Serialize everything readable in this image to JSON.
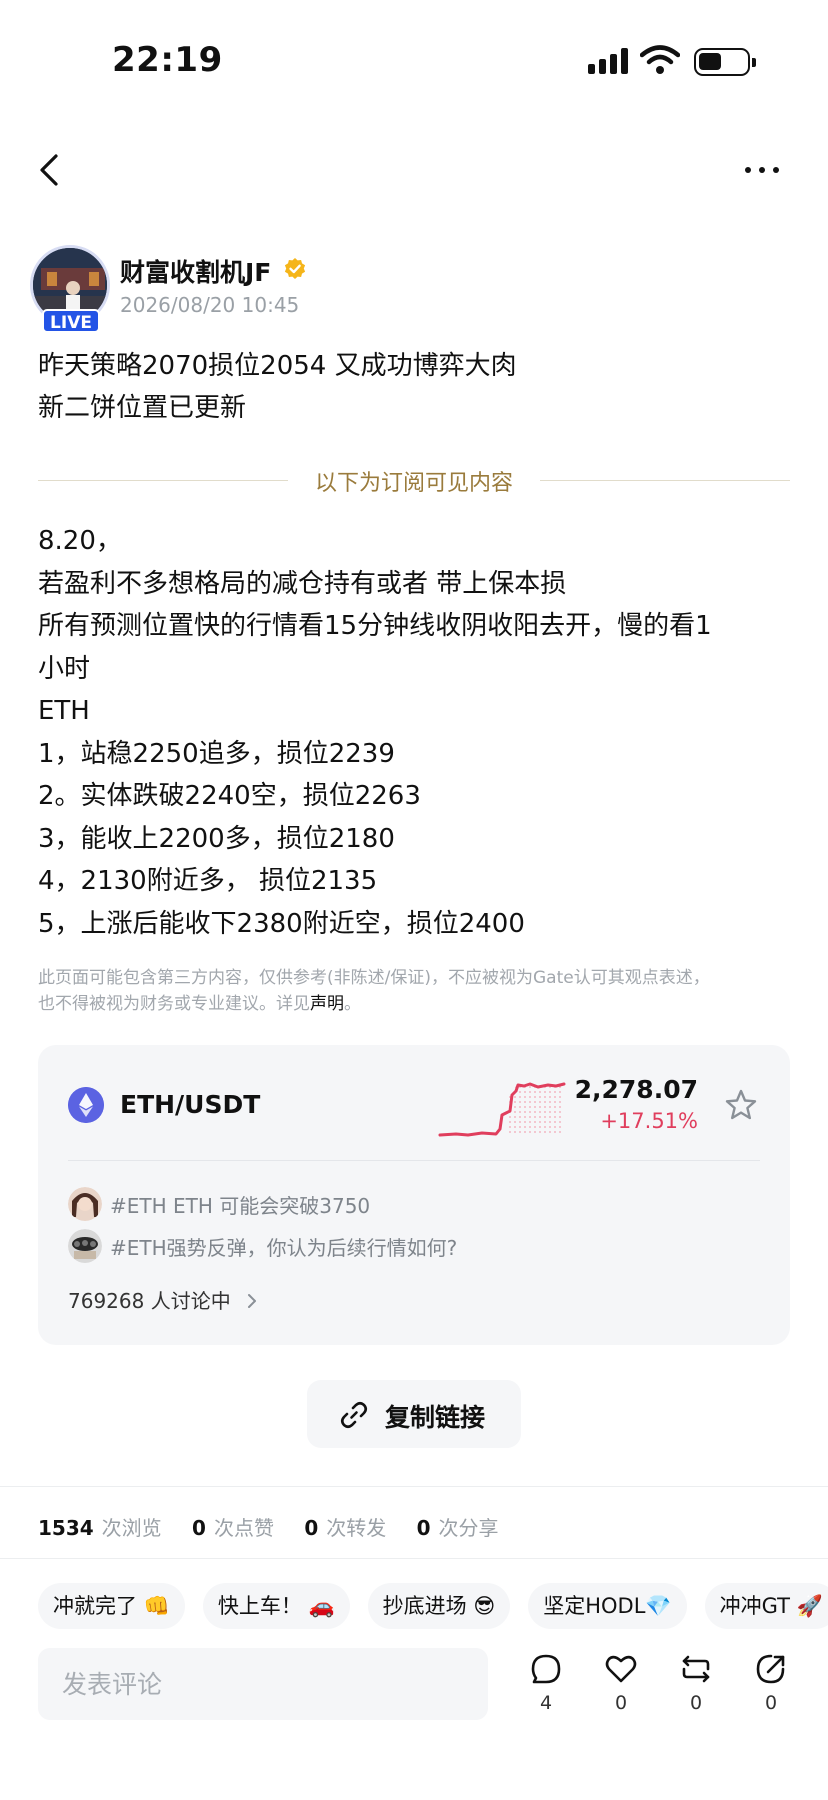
{
  "status_bar": {
    "time": "22:19"
  },
  "author": {
    "name": "财富收割机JF",
    "live_label": "LIVE",
    "date": "2026/08/20 10:45"
  },
  "post": {
    "intro_lines": [
      "昨天策略2070损位2054 又成功博弈大肉",
      "新二饼位置已更新"
    ],
    "subscriber_divider": "以下为订阅可见内容",
    "body_lines": [
      "8.20，",
      "若盈利不多想格局的减仓持有或者 带上保本损",
      "所有预测位置快的行情看15分钟线收阴收阳去开，慢的看1",
      "小时",
      "ETH",
      "1，站稳2250追多，损位2239",
      "2。实体跌破2240空，损位2263",
      "3，能收上2200多，损位2180",
      "4，2130附近多， 损位2135",
      "5，上涨后能收下2380附近空，损位2400"
    ],
    "disclaimer_line1": "此页面可能包含第三方内容，仅供参考(非陈述/保证)，不应被视为Gate认可其观点表述，",
    "disclaimer_line2_prefix": "也不得被视为财务或专业建议。详见",
    "disclaimer_link": "声明",
    "disclaimer_line2_suffix": "。"
  },
  "market_card": {
    "pair": "ETH/USDT",
    "price": "2,278.07",
    "change": "+17.51%",
    "colors": {
      "up": "#e03e5d",
      "coin": "#5b63e2"
    },
    "topics": [
      {
        "text": "#ETH ETH 可能会突破3750"
      },
      {
        "text": "#ETH强势反弹，你认为后续行情如何?"
      }
    ],
    "discussing": "769268 人讨论中"
  },
  "copy_link_label": "复制链接",
  "stats": {
    "views": "1534",
    "views_unit": "次浏览",
    "likes": "0",
    "likes_unit": "次点赞",
    "reposts": "0",
    "reposts_unit": "次转发",
    "shares": "0",
    "shares_unit": "次分享"
  },
  "quick_replies": [
    "冲就完了 👊",
    "快上车！ 🚗",
    "抄底进场 😎",
    "坚定HODL💎",
    "冲冲GT 🚀"
  ],
  "comment": {
    "placeholder": "发表评论"
  },
  "actions": {
    "comments": "4",
    "likes": "0",
    "reposts": "0",
    "shares": "0"
  }
}
